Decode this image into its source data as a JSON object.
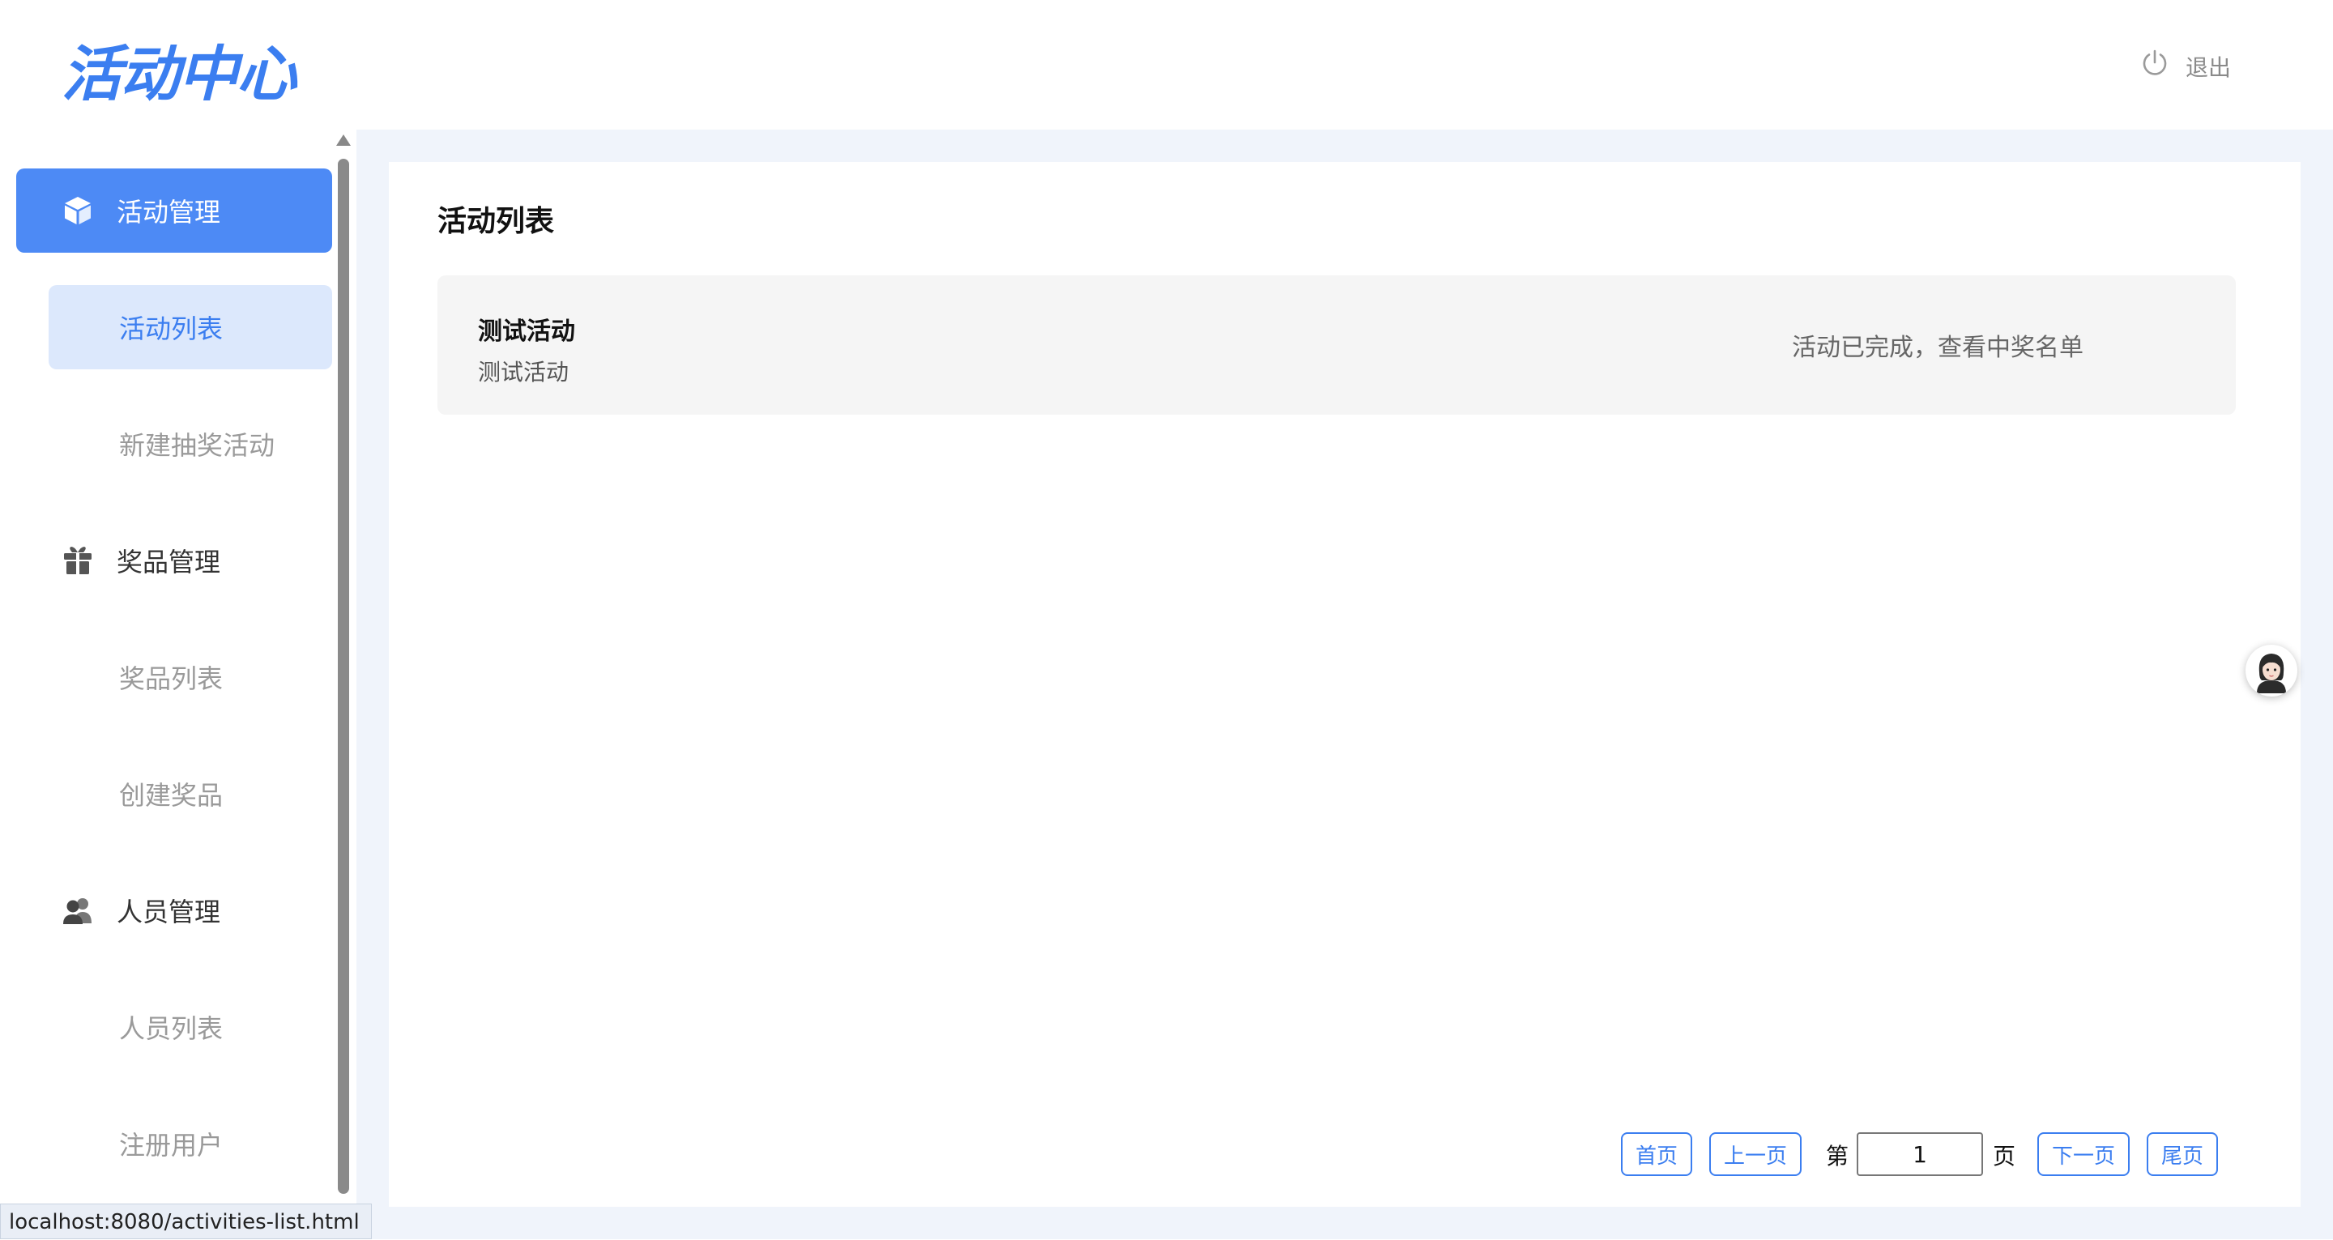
{
  "header": {
    "logo_text": "活动中心",
    "logout_label": "退出",
    "logout_icon": "power-icon"
  },
  "sidebar": {
    "groups": [
      {
        "label": "活动管理",
        "icon": "cube-icon",
        "active": true,
        "items": [
          {
            "label": "活动列表",
            "active": true
          },
          {
            "label": "新建抽奖活动",
            "active": false
          }
        ]
      },
      {
        "label": "奖品管理",
        "icon": "gift-icon",
        "active": false,
        "items": [
          {
            "label": "奖品列表",
            "active": false
          },
          {
            "label": "创建奖品",
            "active": false
          }
        ]
      },
      {
        "label": "人员管理",
        "icon": "users-icon",
        "active": false,
        "items": [
          {
            "label": "人员列表",
            "active": false
          },
          {
            "label": "注册用户",
            "active": false
          }
        ]
      }
    ]
  },
  "main": {
    "title": "活动列表",
    "activities": [
      {
        "name": "测试活动",
        "description": "测试活动",
        "status": "活动已完成，查看中奖名单"
      }
    ]
  },
  "pagination": {
    "first": "首页",
    "prev": "上一页",
    "page_prefix": "第",
    "page_value": "1",
    "page_suffix": "页",
    "next": "下一页",
    "last": "尾页"
  },
  "status_bar": {
    "url": "localhost:8080/activities-list.html"
  },
  "colors": {
    "accent": "#4d8af5",
    "accent_light": "#dce8fc",
    "page_bg": "#f0f4fb"
  }
}
